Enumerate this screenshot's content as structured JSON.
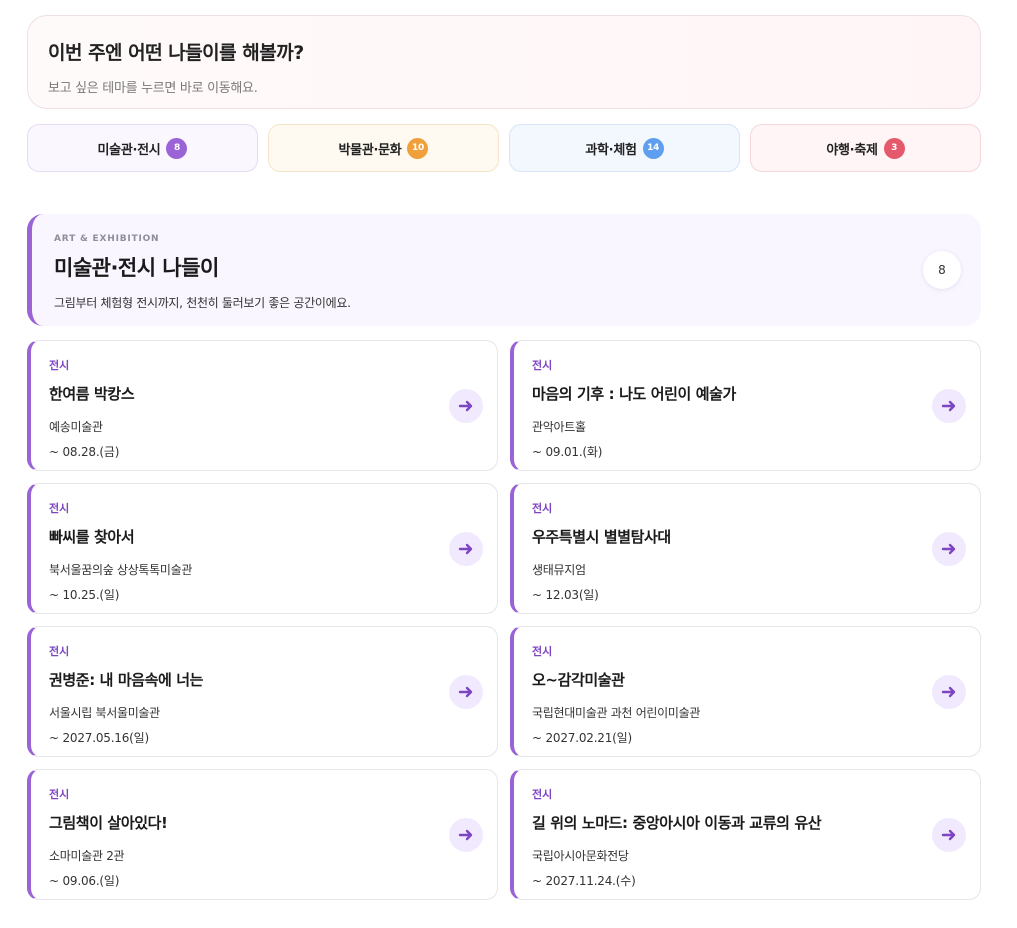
{
  "intro": {
    "title": "이번 주엔 어떤 나들이를 해볼까?",
    "subtitle": "보고 싶은 테마를 누르면 바로 이동해요."
  },
  "themes": [
    {
      "label": "미술관·전시",
      "count": "8",
      "color": "#9a63d6"
    },
    {
      "label": "박물관·문화",
      "count": "10",
      "color": "#f0a03a"
    },
    {
      "label": "과학·체험",
      "count": "14",
      "color": "#5f9fef"
    },
    {
      "label": "야행·축제",
      "count": "3",
      "color": "#e45a6c"
    }
  ],
  "section": {
    "eyebrow": "ART & EXHIBITION",
    "title": "미술관·전시 나들이",
    "description": "그림부터 체험형 전시까지, 천천히 둘러보기 좋은 공간이에요.",
    "count": "8",
    "accent": "#9a63d6"
  },
  "cards": [
    {
      "category": "전시",
      "title": "한여름 박캉스",
      "venue": "예송미술관",
      "date": "~ 08.28.(금)"
    },
    {
      "category": "전시",
      "title": "마음의 기후 : 나도 어린이 예술가",
      "venue": "관악아트홀",
      "date": "~ 09.01.(화)"
    },
    {
      "category": "전시",
      "title": "빠씨를 찾아서",
      "venue": "북서울꿈의숲 상상톡톡미술관",
      "date": "~ 10.25.(일)"
    },
    {
      "category": "전시",
      "title": "우주특별시 별별탐사대",
      "venue": "생태뮤지엄",
      "date": "~ 12.03(일)"
    },
    {
      "category": "전시",
      "title": "권병준: 내 마음속에 너는",
      "venue": "서울시립 북서울미술관",
      "date": "~ 2027.05.16(일)"
    },
    {
      "category": "전시",
      "title": "오~감각미술관",
      "venue": "국립현대미술관 과천 어린이미술관",
      "date": "~ 2027.02.21(일)"
    },
    {
      "category": "전시",
      "title": "그림책이 살아있다!",
      "venue": "소마미술관 2관",
      "date": "~ 09.06.(일)"
    },
    {
      "category": "전시",
      "title": "길 위의 노마드: 중앙아시아 이동과 교류의 유산",
      "venue": "국립아시아문화전당",
      "date": "~ 2027.11.24.(수)"
    }
  ]
}
